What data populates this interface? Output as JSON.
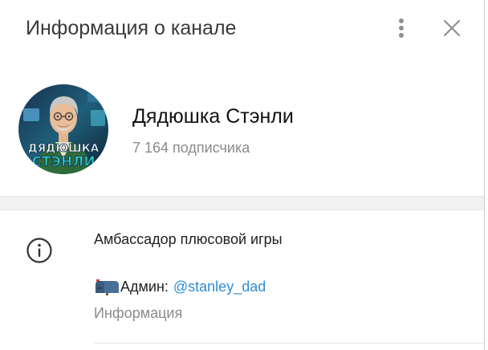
{
  "header": {
    "title": "Информация о канале",
    "more_icon": "more-vertical-icon",
    "close_icon": "close-icon"
  },
  "channel": {
    "name": "Дядюшка Стэнли",
    "subscribers": "7 164 подписчика",
    "avatar_text_line1": "ДЯДЮШКА",
    "avatar_text_line2": "СТЭНЛИ"
  },
  "info": {
    "icon": "info-icon",
    "about": "Амбассадор плюсовой игры",
    "admin_prefix": "Админ:",
    "admin_icon": "mailbox-icon",
    "admin_username": "@stanley_dad",
    "caption": "Информация"
  },
  "colors": {
    "link": "#2e8cd4",
    "muted_text": "#8a8a8a",
    "separator": "#f1f1f1"
  }
}
